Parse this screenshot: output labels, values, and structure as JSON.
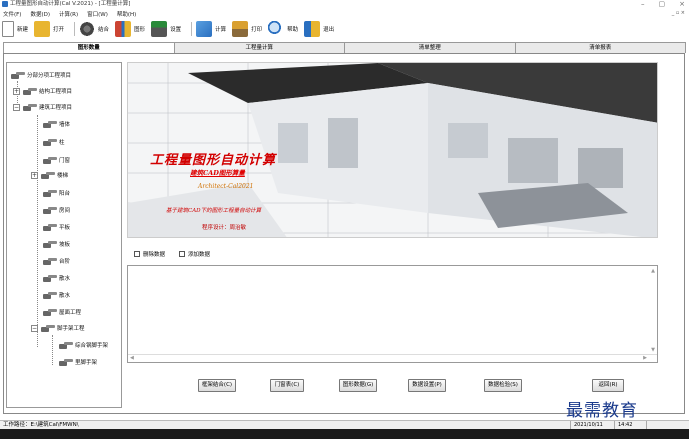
{
  "window": {
    "title": "工程量图形自动计算(Cal V.2021) - [工程量计算]",
    "controls": [
      "–",
      "▢",
      "×"
    ]
  },
  "menu": {
    "items": [
      "文件(F)",
      "数据(D)",
      "计算(R)",
      "窗口(W)",
      "帮助(H)"
    ],
    "mdi_controls": "_ ▫ ×"
  },
  "toolbar": {
    "new": "新建",
    "open": "打开",
    "combine": "结合",
    "shape": "图形",
    "settings": "设置",
    "calculate": "计算",
    "print": "打印",
    "help": "帮助",
    "exit": "退出"
  },
  "tabs": [
    "图形数量",
    "工程量计算",
    "清单整理",
    "清单报表"
  ],
  "tree": {
    "root": "分部分项工程项目",
    "structure": "结构工程项目",
    "building": "建筑工程项目",
    "items": [
      "墙体",
      "柱",
      "门窗",
      "楼梯",
      "阳台",
      "房间",
      "平板",
      "坡板",
      "台阶",
      "散水",
      "散水",
      "屋面工程",
      "脚手架工程"
    ],
    "scaffold_children": [
      "综合钢脚手架",
      "里脚手架"
    ]
  },
  "banner": {
    "title": "工程量图形自动计算",
    "subtitle1": "建筑CAD图形算量",
    "subtitle2": "Architect-Cal2021",
    "subtitle3": "基于建筑CAD下的图形工程量自动计算",
    "author": "程序设计：周治敏"
  },
  "checks": {
    "new_data": "删除数据",
    "add_data": "添加数据"
  },
  "buttons": {
    "frame_combine": "框架结合(C)",
    "door_window": "门窗表(C)",
    "shape_data": "图形数据(G)",
    "data_settings": "数据设置(P)",
    "data_check": "数据检验(S)",
    "back": "返回(R)"
  },
  "status": {
    "path": "工作路径：E:\\建筑Cal\\FMWN\\",
    "date": "2021/10/11",
    "time": "14:42"
  },
  "watermark": "最需教育",
  "colors": {
    "banner_title": "#d20000",
    "accent_blue": "#2a6fc0"
  }
}
